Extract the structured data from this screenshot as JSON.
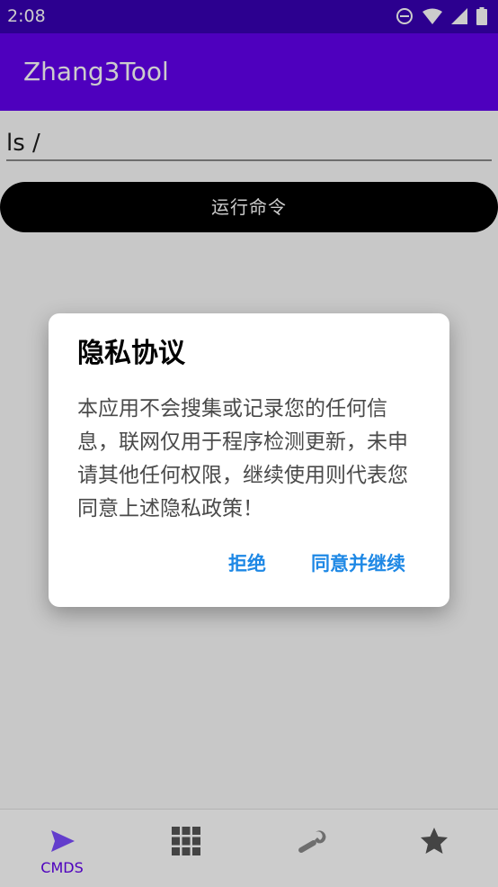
{
  "status_bar": {
    "time": "2:08",
    "icons": [
      "do-not-disturb-icon",
      "wifi-icon",
      "signal-icon",
      "battery-icon"
    ]
  },
  "app_bar": {
    "title": "Zhang3Tool",
    "color": "#6200ee"
  },
  "command": {
    "input_value": "ls /",
    "run_label": "运行命令"
  },
  "bottom_nav": {
    "items": [
      {
        "icon": "send-icon",
        "label": "CMDS",
        "selected": true
      },
      {
        "icon": "grid-icon",
        "label": "",
        "selected": false
      },
      {
        "icon": "wrench-icon",
        "label": "",
        "selected": false
      },
      {
        "icon": "star-icon",
        "label": "",
        "selected": false
      }
    ],
    "accent_color": "#6200ee"
  },
  "dialog": {
    "title": "隐私协议",
    "message": "本应用不会搜集或记录您的任何信息，联网仅用于程序检测更新，未申请其他任何权限，继续使用则代表您同意上述隐私政策！",
    "reject_label": "拒绝",
    "agree_label": "同意并继续",
    "button_color": "#1e88e5"
  }
}
